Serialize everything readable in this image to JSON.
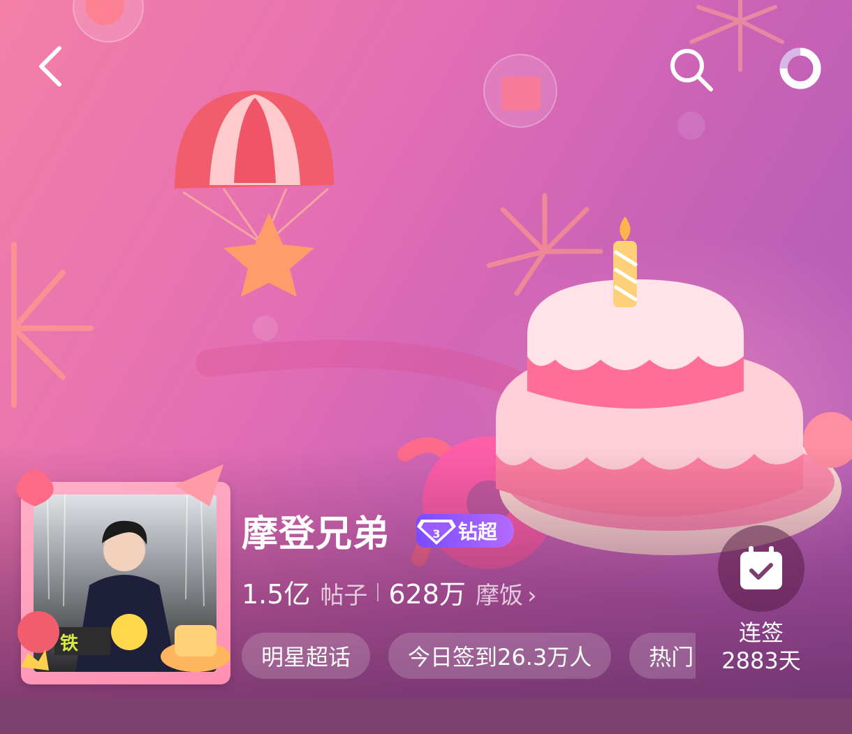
{
  "nav": {
    "back_icon": "chevron-left-icon",
    "search_icon": "search-icon",
    "more_icon": "ring-icon"
  },
  "topic": {
    "title": "摩登兄弟",
    "badge": {
      "icon": "diamond-icon",
      "level": "3",
      "label": "钻超"
    },
    "stats": {
      "posts_value": "1.5亿",
      "posts_label": "帖子",
      "fans_value": "628万",
      "fans_label": "摩饭"
    },
    "tags": [
      "明星超话",
      "今日签到26.3万人",
      "热门"
    ]
  },
  "signin": {
    "icon": "calendar-check-icon",
    "label": "连签",
    "days": "2883天"
  },
  "colors": {
    "bg_start": "#f47fa6",
    "bg_end": "#a758bb",
    "badge_start": "#7b4bff",
    "badge_end": "#b46bff"
  }
}
